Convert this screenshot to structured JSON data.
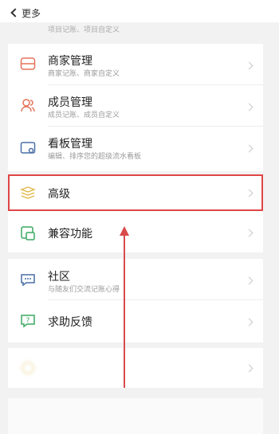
{
  "nav": {
    "back_label": "更多",
    "top_sub": "项目记账、项目自定义"
  },
  "items": [
    {
      "title": "商家管理",
      "sub": "商家记账、商家自定义"
    },
    {
      "title": "成员管理",
      "sub": "成员记账、成员自定义"
    },
    {
      "title": "看板管理",
      "sub": "编辑、排序您的超级流水看板"
    },
    {
      "title": "高级",
      "sub": ""
    },
    {
      "title": "兼容功能",
      "sub": ""
    },
    {
      "title": "社区",
      "sub": "与随友们交流记账心得"
    },
    {
      "title": "求助反馈",
      "sub": ""
    }
  ],
  "colors": {
    "accent": "#e04545",
    "icon_red": "#e5725a",
    "icon_blue": "#4a6fa5",
    "icon_gold": "#e0b84a",
    "icon_green": "#3aa862"
  }
}
